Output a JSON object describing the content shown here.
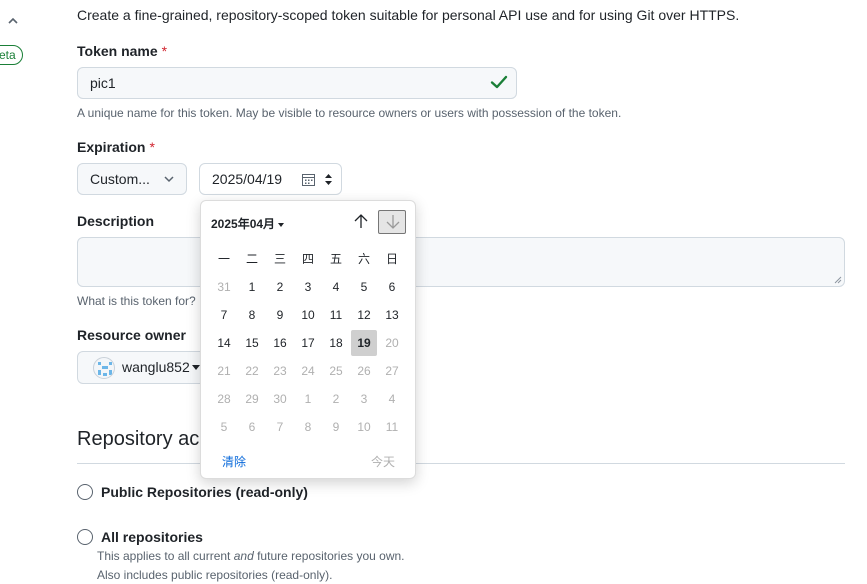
{
  "intro": "Create a fine-grained, repository-scoped token suitable for personal API use and for using Git over HTTPS.",
  "beta_badge": "eta",
  "token_name": {
    "label": "Token name",
    "required": "*",
    "value": "pic1",
    "hint": "A unique name for this token. May be visible to resource owners or users with possession of the token."
  },
  "expiration": {
    "label": "Expiration",
    "required": "*",
    "select_value": "Custom...",
    "date_value": "2025/04/19"
  },
  "description": {
    "label": "Description",
    "hint": "What is this token for?"
  },
  "resource_owner": {
    "label": "Resource owner",
    "value": "wanglu852"
  },
  "repository_access": {
    "title": "Repository access",
    "options": [
      {
        "label": "Public Repositories (read-only)"
      },
      {
        "label": "All repositories"
      }
    ],
    "note_line1_pre": "This applies to all current ",
    "note_line1_em": "and",
    "note_line1_post": " future repositories you own.",
    "note_line2": "Also includes public repositories (read-only)."
  },
  "datepicker": {
    "month": "2025年04月",
    "weekdays": [
      "一",
      "二",
      "三",
      "四",
      "五",
      "六",
      "日"
    ],
    "weeks": [
      [
        [
          "31",
          "dim"
        ],
        [
          "1",
          ""
        ],
        [
          "2",
          ""
        ],
        [
          "3",
          ""
        ],
        [
          "4",
          ""
        ],
        [
          "5",
          ""
        ],
        [
          "6",
          ""
        ]
      ],
      [
        [
          "7",
          ""
        ],
        [
          "8",
          ""
        ],
        [
          "9",
          ""
        ],
        [
          "10",
          ""
        ],
        [
          "11",
          ""
        ],
        [
          "12",
          ""
        ],
        [
          "13",
          ""
        ]
      ],
      [
        [
          "14",
          ""
        ],
        [
          "15",
          ""
        ],
        [
          "16",
          ""
        ],
        [
          "17",
          ""
        ],
        [
          "18",
          ""
        ],
        [
          "19",
          "selected"
        ],
        [
          "20",
          "dim"
        ]
      ],
      [
        [
          "21",
          "dim"
        ],
        [
          "22",
          "dim"
        ],
        [
          "23",
          "dim"
        ],
        [
          "24",
          "dim"
        ],
        [
          "25",
          "dim"
        ],
        [
          "26",
          "dim"
        ],
        [
          "27",
          "dim"
        ]
      ],
      [
        [
          "28",
          "dim"
        ],
        [
          "29",
          "dim"
        ],
        [
          "30",
          "dim"
        ],
        [
          "1",
          "dim"
        ],
        [
          "2",
          "dim"
        ],
        [
          "3",
          "dim"
        ],
        [
          "4",
          "dim"
        ]
      ],
      [
        [
          "5",
          "dim"
        ],
        [
          "6",
          "dim"
        ],
        [
          "7",
          "dim"
        ],
        [
          "8",
          "dim"
        ],
        [
          "9",
          "dim"
        ],
        [
          "10",
          "dim"
        ],
        [
          "11",
          "dim"
        ]
      ]
    ],
    "clear": "清除",
    "today": "今天"
  },
  "colors": {
    "success": "#1a7f37",
    "danger": "#d1242f",
    "link": "#0969da",
    "selected_day_bg": "#cfcfcf"
  },
  "icons": [
    "chevron-up-icon",
    "check-icon",
    "chevron-down-icon",
    "calendar-icon",
    "spinner-icon",
    "resize-handle-icon",
    "avatar-icon",
    "arrow-up-icon",
    "arrow-down-icon"
  ]
}
